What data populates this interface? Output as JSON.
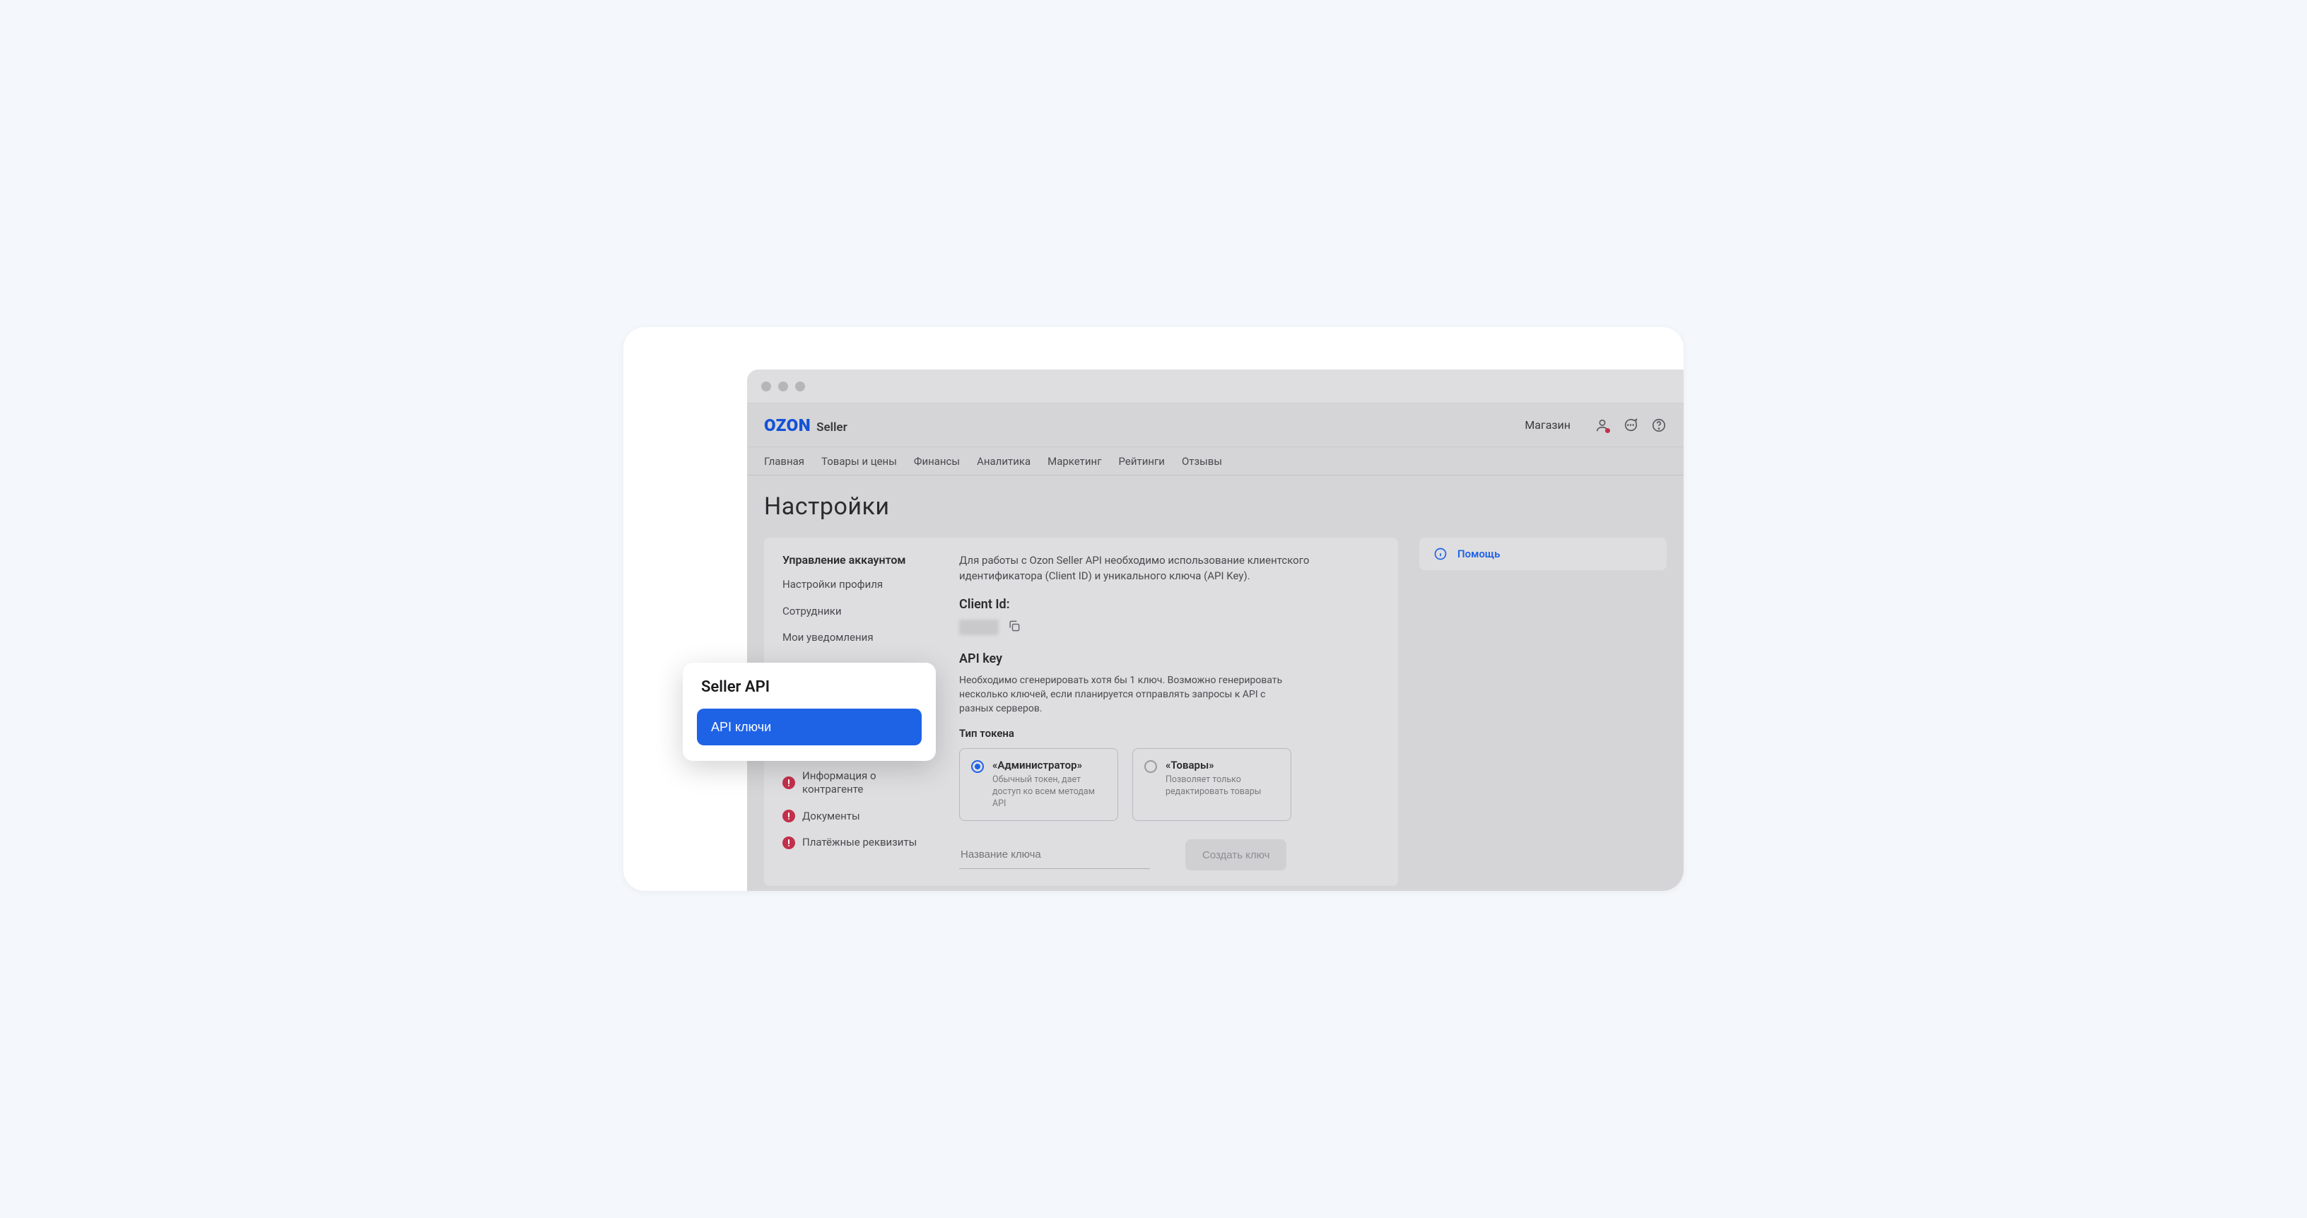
{
  "brand": {
    "logo1": "OZON",
    "logo2": "Seller"
  },
  "topbar": {
    "store": "Магазин"
  },
  "nav": [
    "Главная",
    "Товары и цены",
    "Финансы",
    "Аналитика",
    "Маркетинг",
    "Рейтинги",
    "Отзывы"
  ],
  "page_title": "Настройки",
  "sidebar": {
    "heading": "Управление аккаунтом",
    "items_top": [
      "Настройки профиля",
      "Сотрудники",
      "Мои уведомления"
    ],
    "items_bottom": [
      "Информация о контрагенте",
      "Документы",
      "Платёжные реквизиты"
    ]
  },
  "content": {
    "desc": "Для работы с Ozon Seller API необходимо использование клиентского идентификатора (Client ID) и уникального ключа (API Key).",
    "client_id_label": "Client Id:",
    "api_key_label": "API key",
    "api_key_desc": "Необходимо сгенерировать хотя бы 1 ключ. Возможно генерировать несколько ключей, если планируется отправлять запросы к API с разных серверов.",
    "token_type_label": "Тип токена",
    "cards": [
      {
        "title": "«Администратор»",
        "sub": "Обычный токен, дает доступ ко всем методам API"
      },
      {
        "title": "«Товары»",
        "sub": "Позволяет только редактировать товары"
      }
    ],
    "key_name_placeholder": "Название ключа",
    "create_button": "Создать ключ"
  },
  "help": {
    "label": "Помощь"
  },
  "popup": {
    "title": "Seller API",
    "button": "API ключи"
  }
}
